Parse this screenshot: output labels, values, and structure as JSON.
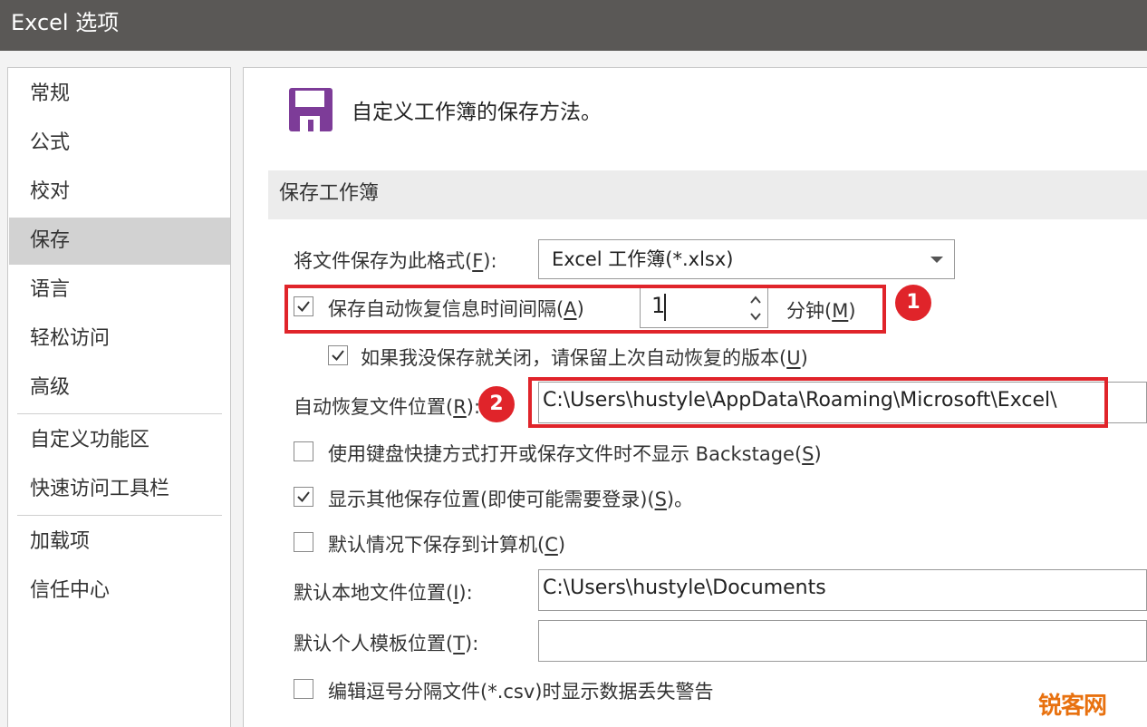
{
  "window": {
    "title": "Excel 选项"
  },
  "sidebar": {
    "items": [
      {
        "label": "常规"
      },
      {
        "label": "公式"
      },
      {
        "label": "校对"
      },
      {
        "label": "保存",
        "selected": true
      },
      {
        "label": "语言"
      },
      {
        "label": "轻松访问"
      },
      {
        "label": "高级"
      },
      {
        "label": "自定义功能区"
      },
      {
        "label": "快速访问工具栏"
      },
      {
        "label": "加载项"
      },
      {
        "label": "信任中心"
      }
    ]
  },
  "header": {
    "icon": "floppy-disk-icon",
    "text": "自定义工作簿的保存方法。"
  },
  "section": {
    "title": "保存工作簿"
  },
  "format": {
    "label_prefix": "将文件保存为此格式(",
    "label_key": "F",
    "label_suffix": "):",
    "value": "Excel 工作簿(*.xlsx)"
  },
  "autorecover": {
    "label_prefix": "保存自动恢复信息时间间隔(",
    "label_key": "A",
    "label_suffix": ")",
    "checked": true,
    "value": "1",
    "unit_prefix": "分钟(",
    "unit_key": "M",
    "unit_suffix": ")"
  },
  "keep_last": {
    "label_prefix": "如果我没保存就关闭，请保留上次自动恢复的版本(",
    "label_key": "U",
    "label_suffix": ")",
    "checked": true
  },
  "autorecover_location": {
    "label_prefix": "自动恢复文件位置(",
    "label_key": "R",
    "label_suffix": "):",
    "value": "C:\\Users\\hustyle\\AppData\\Roaming\\Microsoft\\Excel\\"
  },
  "no_backstage": {
    "label_prefix": "使用键盘快捷方式打开或保存文件时不显示 Backstage(",
    "label_key": "S",
    "label_suffix": ")",
    "checked": false
  },
  "show_other": {
    "label_prefix": "显示其他保存位置(即使可能需要登录)(",
    "label_key": "S",
    "label_suffix": ")。",
    "checked": true
  },
  "save_to_computer": {
    "label_prefix": "默认情况下保存到计算机(",
    "label_key": "C",
    "label_suffix": ")",
    "checked": false
  },
  "default_local": {
    "label_prefix": "默认本地文件位置(",
    "label_key": "I",
    "label_suffix": "):",
    "value": "C:\\Users\\hustyle\\Documents"
  },
  "personal_template": {
    "label_prefix": "默认个人模板位置(",
    "label_key": "T",
    "label_suffix": "):",
    "value": ""
  },
  "csv_warning": {
    "label": "编辑逗号分隔文件(*.csv)时显示数据丢失警告",
    "checked": false
  },
  "annotations": {
    "badge1": "1",
    "badge2": "2"
  },
  "watermark": {
    "text": "锐客网"
  },
  "colors": {
    "accent_red": "#e0242a",
    "selected_nav": "#d2d2d2",
    "titlebar": "#5a5856",
    "icon_purple": "#7d3c98"
  }
}
